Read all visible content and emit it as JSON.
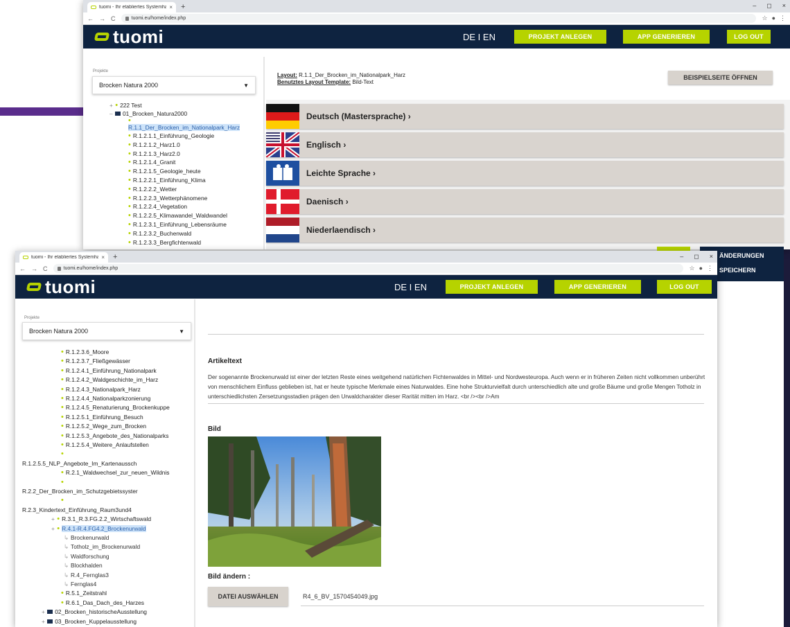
{
  "browser": {
    "tab_title": "tuomi - Ihr etabliertes Systemha",
    "tab_title_front": "tuomi - Ihr etabliertes Systemha",
    "url": "tuomi.eu/home/index.php",
    "new_tab": "+",
    "tab_close": "×",
    "nav_back": "←",
    "nav_forward": "→",
    "nav_reload": "C",
    "star": "☆",
    "profile": "●",
    "menu": "⋮",
    "min": "–",
    "restore": "◻",
    "close": "×"
  },
  "header": {
    "logo": "tuomi",
    "lang": "DE I EN",
    "btn_projekt": "PROJEKT ANLEGEN",
    "btn_app": "APP GENERIEREN",
    "btn_logout": "LOG OUT"
  },
  "sidebar": {
    "projects_label": "Projekte",
    "selected_project": "Brocken Natura 2000",
    "caret": "▼"
  },
  "back_tree": [
    "222 Test",
    "01_Brocken_Natura2000",
    "R.1.1_Der_Brocken_im_Nationalpark_Harz",
    "R.1.2.1.1_Einführung_Geologie",
    "R.1.2.1.2_Harz1.0",
    "R.1.2.1.3_Harz2.0",
    "R.1.2.1.4_Granit",
    "R.1.2.1.5_Geologie_heute",
    "R.1.2.2.1_Einführung_Klima",
    "R.1.2.2.2_Wetter",
    "R.1.2.2.3_Wetterphänomene",
    "R.1.2.2.4_Vegetation",
    "R.1.2.2.5_Klimawandel_Waldwandel",
    "R.1.2.3.1_Einführung_Lebensräume",
    "R.1.2.3.2_Buchenwald",
    "R.1.2.3.3_Bergfichtenwald"
  ],
  "layout_info": {
    "layout_label": "Layout:",
    "layout_value": "R.1.1_Der_Brocken_im_Nationalpark_Harz",
    "template_label": "Benutztes Layout Template:",
    "template_value": "Bild-Text",
    "btn_beispiel": "BEISPIELSEITE ÖFFNEN"
  },
  "languages": [
    "Deutsch (Mastersprache) ›",
    "Englisch ›",
    "Leichte Sprache ›",
    "Daenisch ›",
    "Niederlaendisch ›"
  ],
  "save_button": {
    "line1": "ÄNDERUNGEN",
    "line2": "SPEICHERN"
  },
  "front_tree": [
    "R.1.2.3.6_Moore",
    "R.1.2.3.7_Fließgewässer",
    "R.1.2.4.1_Einführung_Nationalpark",
    "R.1.2.4.2_Waldgeschichte_im_Harz",
    "R.1.2.4.3_Nationalpark_Harz",
    "R.1.2.4.4_Nationalparkzonierung",
    "R.1.2.4.5_Renaturierung_Brockenkuppe",
    "R.1.2.5.1_Einführung_Besuch",
    "R.1.2.5.2_Wege_zum_Brocken",
    "R.1.2.5.3_Angebote_des_Nationalparks",
    "R.1.2.5.4_Weitere_Anlaufstellen",
    "R.1.2.5.5_NLP_Angebote_Im_Kartenaussch",
    "R.2.1_Waldwechsel_zur_neuen_Wildnis",
    "R.2.2_Der_Brocken_im_Schutzgebietssyster",
    "R.2.3_Kindertext_Einführung_Raum3und4",
    "R.3.1_R.3.FG.2.2_Wirtschaftswald",
    "R.4.1-R.4.FG4.2_Brockenurwald",
    "Brockenurwald",
    "Totholz_im_Brockenurwald",
    "Waldforschung",
    "Blockhalden",
    "R.4_Fernglas3",
    "Fernglas4",
    "R.5.1_Zeitstrahl",
    "R.6.1_Das_Dach_des_Harzes",
    "02_Brocken_historischeAusstellung",
    "03_Brocken_Kuppelausstellung"
  ],
  "article": {
    "title": "Artikeltext",
    "body": "Der sogenannte Brockenurwald ist einer der letzten Reste eines weitgehend natürlichen Fichtenwaldes in Mittel- und Nordwesteuropa. Auch wenn er in früheren Zeiten nicht vollkommen unberührt von menschlichem Einfluss geblieben ist, hat er heute typische Merkmale eines Naturwaldes. Eine hohe Strukturvielfalt durch unterschiedlich alte und große Bäume und große Mengen Totholz in unterschiedlichsten Zersetzungsstadien prägen den Urwaldcharakter dieser Rarität mitten im Harz. <br /><br />Am",
    "image_title": "Bild",
    "change_label": "Bild ändern :",
    "btn_file": "DATEI AUSWÄHLEN",
    "filename": "R4_6_BV_1570454049.jpg"
  },
  "colors": {
    "accent": "#b6d300",
    "navy": "#0e2340",
    "grey_row": "#d9d4cf"
  }
}
